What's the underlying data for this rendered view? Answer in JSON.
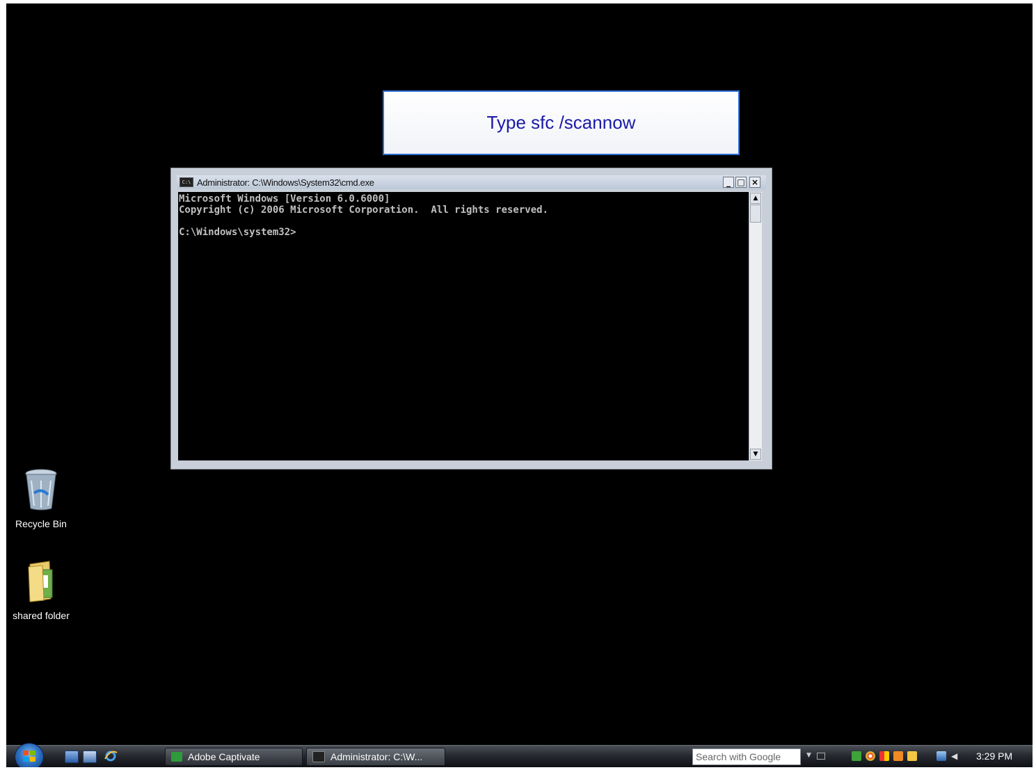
{
  "caption": {
    "text": "Type sfc /scannow"
  },
  "cmd_window": {
    "title": "Administrator: C:\\Windows\\System32\\cmd.exe",
    "icon": "cmd-icon",
    "controls": {
      "minimize": "_",
      "maximize": "□",
      "close": "×"
    },
    "lines": [
      "Microsoft Windows [Version 6.0.6000]",
      "Copyright (c) 2006 Microsoft Corporation.  All rights reserved.",
      "",
      "C:\\Windows\\system32>"
    ]
  },
  "desktop": {
    "icons": [
      {
        "label": "Recycle Bin",
        "icon": "recycle-bin-icon"
      },
      {
        "label": "shared folder",
        "icon": "folder-icon"
      }
    ]
  },
  "taskbar": {
    "quick_launch": [
      "show-desktop-icon",
      "switch-windows-icon",
      "internet-explorer-icon"
    ],
    "tasks": [
      {
        "label": "Adobe Captivate",
        "icon": "captivate-icon",
        "color": "#2f9a3b"
      },
      {
        "label": "Administrator: C:\\W...",
        "icon": "cmd-icon",
        "color": "#222222"
      }
    ],
    "search": {
      "placeholder": "Search with Google"
    },
    "tray_icons": [
      "green-app-icon",
      "chrome-like-icon",
      "flag-icon",
      "orange-app-icon",
      "security-icon",
      "network-icon",
      "volume-icon"
    ],
    "clock": "3:29 PM"
  },
  "colors": {
    "caption_text": "#1a1aa8",
    "caption_border": "#2f6fd6",
    "console_text": "#c0c0c0"
  }
}
